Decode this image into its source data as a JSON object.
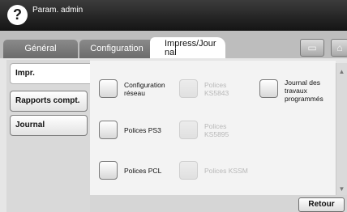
{
  "header": {
    "help_icon_text": "?",
    "user": "Param. admin"
  },
  "tabs": [
    {
      "label": "Général"
    },
    {
      "label": "Configuration"
    },
    {
      "label": "Impress/Jour nal",
      "line1": "Impress/Jour",
      "line2": "nal"
    }
  ],
  "toolbar": {
    "box_icon": "tray-icon",
    "home_icon": "home-icon"
  },
  "sidebar": {
    "items": [
      {
        "label": "Impr."
      },
      {
        "label": "Rapports compt."
      },
      {
        "label": "Journal"
      }
    ]
  },
  "options": [
    {
      "label_l1": "Configuration",
      "label_l2": "réseau",
      "enabled": true
    },
    {
      "label_l1": "Polices PS3",
      "enabled": true
    },
    {
      "label_l1": "Polices PCL",
      "enabled": true
    },
    {
      "label_l1": "Polices",
      "label_l2": "KS5843",
      "enabled": false
    },
    {
      "label_l1": "Polices",
      "label_l2": "KS5895",
      "enabled": false
    },
    {
      "label_l1": "Polices KSSM",
      "enabled": false
    },
    {
      "label_l1": "Journal des",
      "label_l2": "travaux",
      "label_l3": "programmés",
      "enabled": true
    }
  ],
  "footer": {
    "back_label": "Retour"
  }
}
